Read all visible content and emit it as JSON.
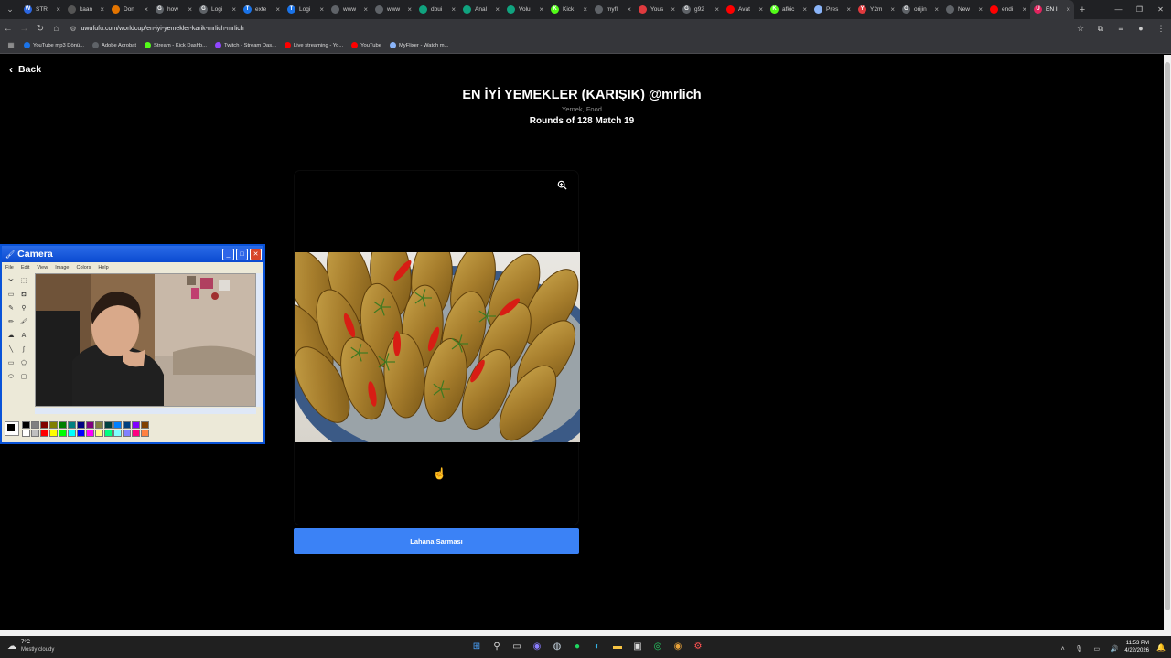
{
  "browser": {
    "tabs": [
      {
        "label": "STR",
        "fav": "#2b66e0",
        "fav_text": "W"
      },
      {
        "label": "kaan",
        "fav": "#555555",
        "fav_text": ""
      },
      {
        "label": "Don",
        "fav": "#e37400",
        "fav_text": ""
      },
      {
        "label": "how",
        "fav": "#5f6368",
        "fav_text": "G"
      },
      {
        "label": "Logi",
        "fav": "#5f6368",
        "fav_text": "G"
      },
      {
        "label": "exte",
        "fav": "#1a73e8",
        "fav_text": "T"
      },
      {
        "label": "Logi",
        "fav": "#1a73e8",
        "fav_text": "T"
      },
      {
        "label": "www",
        "fav": "#5f6368",
        "fav_text": ""
      },
      {
        "label": "www",
        "fav": "#5f6368",
        "fav_text": ""
      },
      {
        "label": "dbui",
        "fav": "#10a37f",
        "fav_text": ""
      },
      {
        "label": "Anal",
        "fav": "#10a37f",
        "fav_text": ""
      },
      {
        "label": "Volu",
        "fav": "#10a37f",
        "fav_text": ""
      },
      {
        "label": "Kick",
        "fav": "#53fc18",
        "fav_text": "K"
      },
      {
        "label": "myfl",
        "fav": "#5f6368",
        "fav_text": ""
      },
      {
        "label": "Yous",
        "fav": "#e03a3e",
        "fav_text": ""
      },
      {
        "label": "g92",
        "fav": "#5f6368",
        "fav_text": "G"
      },
      {
        "label": "Avat",
        "fav": "#ff0000",
        "fav_text": ""
      },
      {
        "label": "afkic",
        "fav": "#53fc18",
        "fav_text": "K"
      },
      {
        "label": "Pres",
        "fav": "#8ab4f8",
        "fav_text": ""
      },
      {
        "label": "Y2m",
        "fav": "#e03a3e",
        "fav_text": "Y"
      },
      {
        "label": "orijin",
        "fav": "#5f6368",
        "fav_text": "G"
      },
      {
        "label": "New",
        "fav": "#5f6368",
        "fav_text": ""
      },
      {
        "label": "endi",
        "fav": "#ff0000",
        "fav_text": ""
      },
      {
        "label": "EN I",
        "fav": "#e0245e",
        "fav_text": "U",
        "active": true
      }
    ],
    "url": "uwufufu.com/worldcup/en-iyi-yemekler-karik-mrlich-mrlich",
    "bookmarks": [
      {
        "label": "YouTube mp3 Dönü...",
        "fav": "#1a73e8"
      },
      {
        "label": "Adobe Acrobat",
        "fav": "#5f6368"
      },
      {
        "label": "Stream - Kick Dashb...",
        "fav": "#53fc18"
      },
      {
        "label": "Twitch - Stream Das...",
        "fav": "#9146ff"
      },
      {
        "label": "Live streaming - Yo...",
        "fav": "#ff0000"
      },
      {
        "label": "YouTube",
        "fav": "#ff0000"
      },
      {
        "label": "MyFlixer - Watch m...",
        "fav": "#8ab4f8"
      }
    ]
  },
  "page": {
    "back_label": "Back",
    "title": "EN İYİ YEMEKLER (KARIŞIK) @mrlich",
    "subtitle": "Yemek, Food",
    "rounds": "Rounds of 128 Match 19",
    "choice_label": "Lahana Sarması",
    "accent_color": "#3b82f6"
  },
  "paint": {
    "title": "Camera",
    "menu": [
      "File",
      "Edit",
      "View",
      "Image",
      "Colors",
      "Help"
    ],
    "palette_row1": [
      "#000000",
      "#808080",
      "#800000",
      "#808000",
      "#008000",
      "#008080",
      "#000080",
      "#800080",
      "#808040",
      "#004040",
      "#0080ff",
      "#004080",
      "#8000ff",
      "#804000"
    ],
    "palette_row2": [
      "#ffffff",
      "#c0c0c0",
      "#ff0000",
      "#ffff00",
      "#00ff00",
      "#00ffff",
      "#0000ff",
      "#ff00ff",
      "#ffff80",
      "#00ff80",
      "#80ffff",
      "#8080ff",
      "#ff0080",
      "#ff8040"
    ]
  },
  "taskbar": {
    "temperature": "7°C",
    "condition": "Mostly cloudy",
    "time": "11:53 PM",
    "date": "4/22/2026"
  }
}
